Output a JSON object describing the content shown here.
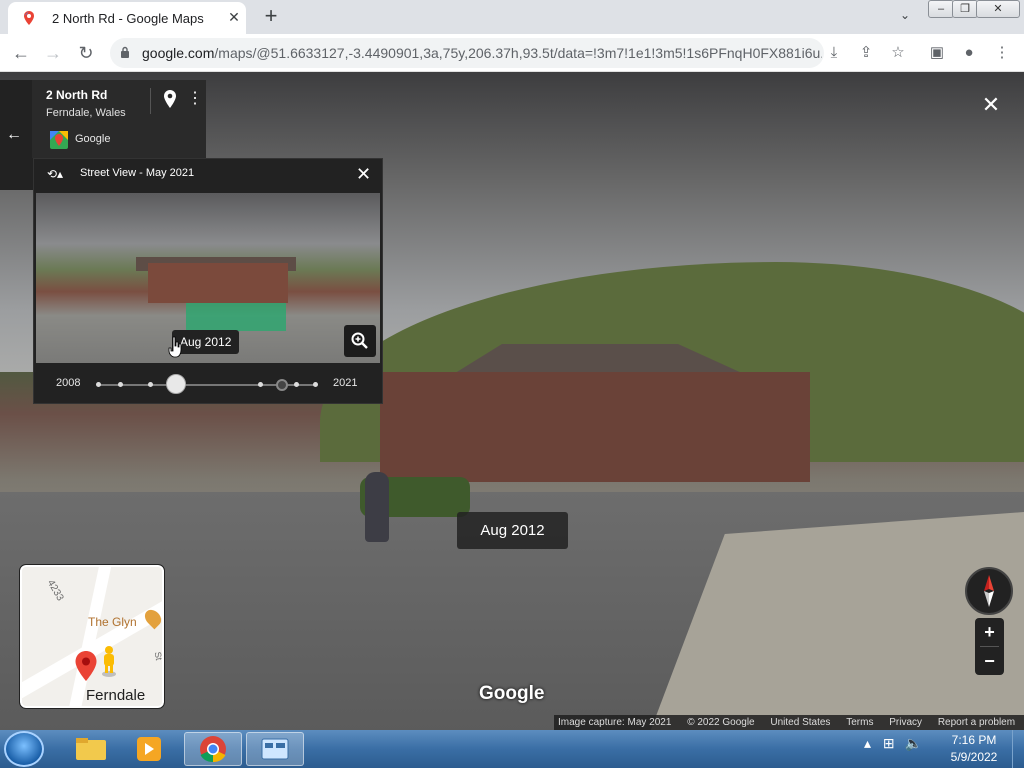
{
  "browser": {
    "tab_title": "2 North Rd - Google Maps",
    "url_host": "google.com",
    "url_path": "/maps/@51.6633127,-3.4490901,3a,75y,206.37h,93.5t/data=!3m7!1e1!3m5!1s6PFnqH0FX881i6u..."
  },
  "place": {
    "title": "2 North Rd",
    "subtitle": "Ferndale, Wales",
    "source": "Google"
  },
  "time_machine": {
    "title": "Street View - May 2021",
    "tooltip": "Aug 2012",
    "year_start": "2008",
    "year_end": "2021",
    "selected_position": 0.35
  },
  "date_badge": "Aug 2012",
  "minimap": {
    "road_number": "4233",
    "poi": "The Glyn",
    "town": "Ferndale",
    "side_label": "St"
  },
  "watermark": "Google",
  "attribution": {
    "capture": "Image capture: May 2021",
    "copyright": "© 2022 Google",
    "region": "United States",
    "terms": "Terms",
    "privacy": "Privacy",
    "report": "Report a problem"
  },
  "taskbar": {
    "time": "7:16 PM",
    "date": "5/9/2022"
  },
  "colors": {
    "dark_panel": "#222222",
    "chrome_tabstrip": "#dee1e6",
    "map_pin": "#ea4335",
    "taskbar": "#3a6ea5"
  }
}
